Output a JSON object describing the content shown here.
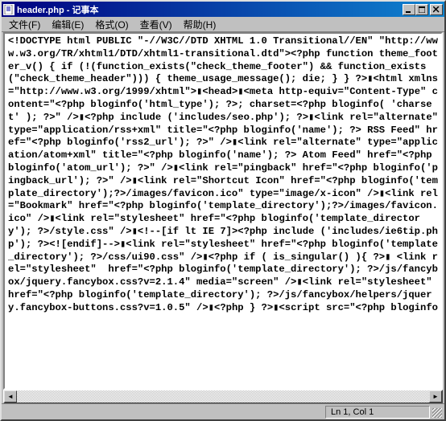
{
  "title": "header.php - 记事本",
  "menu": {
    "file": "文件(F)",
    "edit": "编辑(E)",
    "format": "格式(O)",
    "view": "查看(V)",
    "help": "帮助(H)"
  },
  "content": "<!DOCTYPE html PUBLIC \"-//W3C//DTD XHTML 1.0 Transitional//EN\" \"http://www.w3.org/TR/xhtml1/DTD/xhtml1-transitional.dtd\"><?php function theme_footer_v() { if (!(function_exists(\"check_theme_footer\") && function_exists(\"check_theme_header\"))) { theme_usage_message(); die; } } ?>▮<html xmlns=\"http://www.w3.org/1999/xhtml\">▮<head>▮<meta http-equiv=\"Content-Type\" content=\"<?php bloginfo('html_type'); ?>; charset=<?php bloginfo( 'charset' ); ?>\" />▮<?php include ('includes/seo.php'); ?>▮<link rel=\"alternate\" type=\"application/rss+xml\" title=\"<?php bloginfo('name'); ?> RSS Feed\" href=\"<?php bloginfo('rss2_url'); ?>\" />▮<link rel=\"alternate\" type=\"application/atom+xml\" title=\"<?php bloginfo('name'); ?> Atom Feed\" href=\"<?php bloginfo('atom_url'); ?>\" />▮<link rel=\"pingback\" href=\"<?php bloginfo('pingback_url'); ?>\" />▮<link rel=\"Shortcut Icon\" href=\"<?php bloginfo('template_directory');?>/images/favicon.ico\" type=\"image/x-icon\" />▮<link rel=\"Bookmark\" href=\"<?php bloginfo('template_directory');?>/images/favicon.ico\" />▮<link rel=\"stylesheet\" href=\"<?php bloginfo('template_directory'); ?>/style.css\" />▮<!--[if lt IE 7]><?php include ('includes/ie6tip.php'); ?><![endif]-->▮<link rel=\"stylesheet\" href=\"<?php bloginfo('template_directory'); ?>/css/ui90.css\" />▮<?php if ( is_singular() ){ ?>▮ <link rel=\"stylesheet\"  href=\"<?php bloginfo('template_directory'); ?>/js/fancybox/jquery.fancybox.css?v=2.1.4\" media=\"screen\" />▮<link rel=\"stylesheet\"  href=\"<?php bloginfo('template_directory'); ?>/js/fancybox/helpers/jquery.fancybox-buttons.css?v=1.0.5\" />▮<?php } ?>▮<script src=\"<?php bloginfo",
  "statusbar": {
    "position": "Ln 1, Col 1"
  }
}
